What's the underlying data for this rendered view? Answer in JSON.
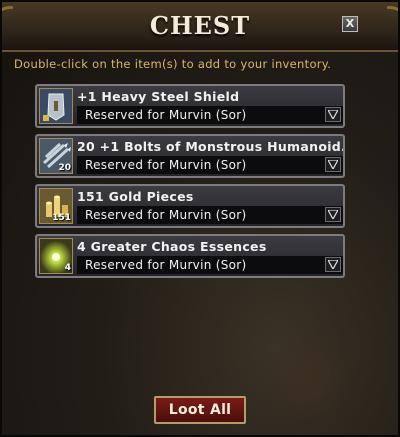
{
  "window": {
    "title": "CHEST",
    "close_label": "X",
    "instructions": "Double-click on the item(s) to add to your inventory."
  },
  "items": [
    {
      "name": "+1 Heavy Steel Shield",
      "count": "",
      "reserved": "Reserved for Murvin (Sor)",
      "icon": "shield-icon"
    },
    {
      "name": "20 +1 Bolts of Monstrous Humanoid...",
      "count": "20",
      "reserved": "Reserved for Murvin (Sor)",
      "icon": "bolts-icon"
    },
    {
      "name": "151 Gold Pieces",
      "count": "151",
      "reserved": "Reserved for Murvin (Sor)",
      "icon": "gold-icon"
    },
    {
      "name": "4 Greater Chaos Essences",
      "count": "4",
      "reserved": "Reserved for Murvin (Sor)",
      "icon": "chaos-essence-icon"
    }
  ],
  "loot_all_label": "Loot All",
  "colors": {
    "instruction_text": "#d9b76a",
    "loot_button": "#7a1c18",
    "item_border": "#7d7b80"
  }
}
